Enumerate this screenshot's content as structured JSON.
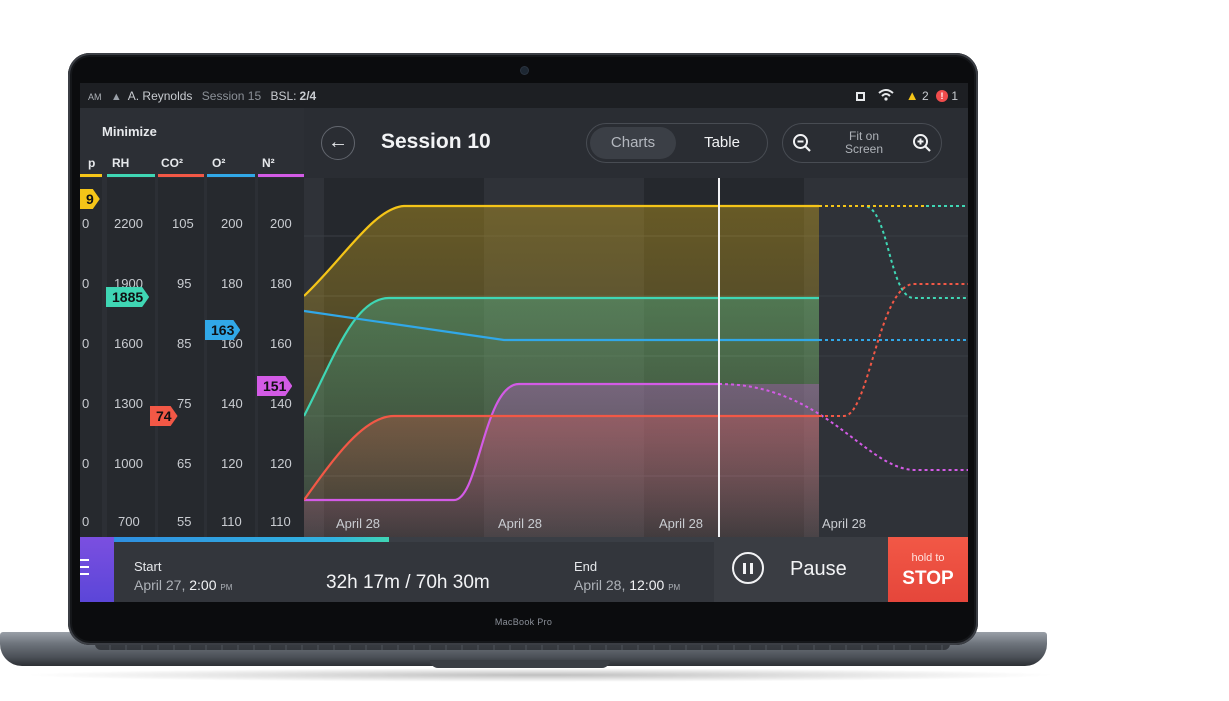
{
  "device": {
    "brand": "MacBook Pro"
  },
  "statusbar": {
    "time": "AM",
    "user": "A. Reynolds",
    "session": "Session 15",
    "bsl_label": "BSL:",
    "bsl_value": "2/4",
    "warnings": "2",
    "errors": "1"
  },
  "side": {
    "minimize": "Minimize",
    "columns": [
      {
        "label": "p",
        "color": "#f5c518"
      },
      {
        "label": "RH",
        "color": "#3fd6b4"
      },
      {
        "label": "CO²",
        "color": "#f25846"
      },
      {
        "label": "O²",
        "color": "#31a8e8"
      },
      {
        "label": "N²",
        "color": "#d35be6"
      }
    ],
    "ticks": {
      "c0": [
        "0",
        "0",
        "0",
        "0",
        "0",
        "0"
      ],
      "c1": [
        "2200",
        "1900",
        "1600",
        "1300",
        "1000",
        "700"
      ],
      "c2": [
        "105",
        "95",
        "85",
        "75",
        "65",
        "55"
      ],
      "c3": [
        "200",
        "180",
        "160",
        "140",
        "120",
        "110"
      ],
      "c4": [
        "200",
        "180",
        "160",
        "140",
        "120",
        "110"
      ]
    },
    "flags": {
      "p": "9",
      "rh": "1885",
      "o2": "163",
      "n2": "151",
      "co2": "74"
    }
  },
  "header": {
    "title": "Session 10",
    "tab_charts": "Charts",
    "tab_table": "Table",
    "fit_on_screen": "Fit on Screen"
  },
  "chart_data": {
    "type": "line",
    "x_labels": [
      "April 28",
      "April 28",
      "April 28",
      "April 28"
    ],
    "series": [
      {
        "color": "#f5c518"
      },
      {
        "color": "#3fd6b4"
      },
      {
        "color": "#31a8e8"
      },
      {
        "color": "#d35be6"
      },
      {
        "color": "#f25846"
      }
    ],
    "grid": true
  },
  "bottom": {
    "start_label": "Start",
    "start_date": "April 27,",
    "start_time": "2:00",
    "start_ampm": "PM",
    "elapsed": "32h 17m / 70h 30m",
    "progress": 0.458,
    "end_label": "End",
    "end_date": "April 28,",
    "end_time": "12:00",
    "end_ampm": "PM",
    "pause": "Pause",
    "hold_to": "hold to",
    "stop": "STOP"
  }
}
